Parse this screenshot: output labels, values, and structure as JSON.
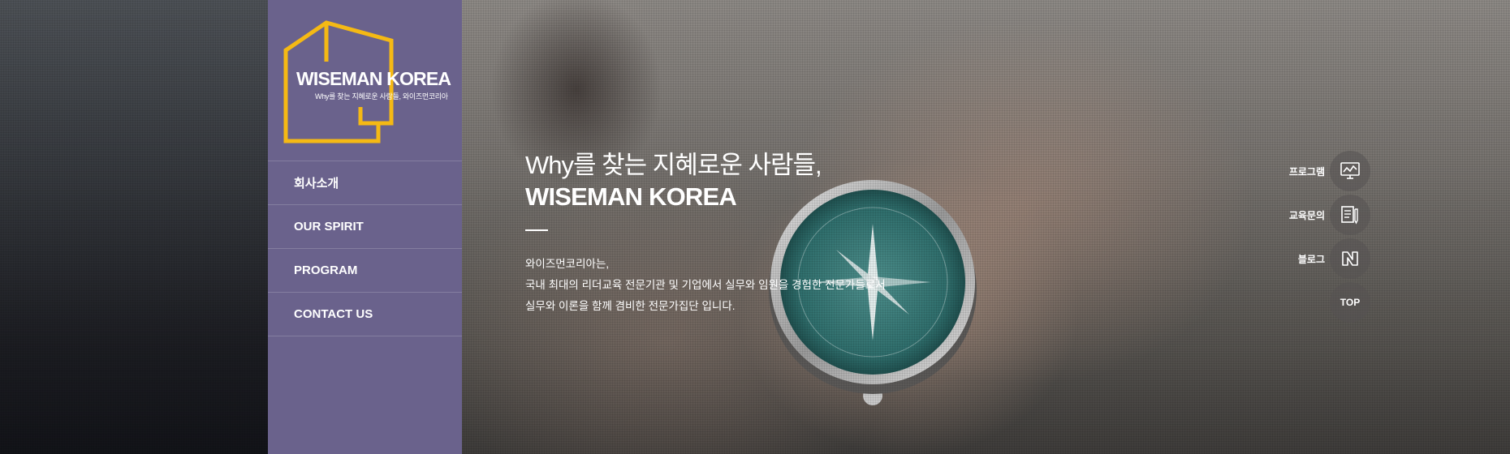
{
  "logo": {
    "title": "WISEMAN KOREA",
    "subtitle": "Why를 찾는 지혜로운 사람들, 와이즈먼코리아",
    "frame_color": "#f5b914"
  },
  "nav": {
    "items": [
      {
        "label": "회사소개"
      },
      {
        "label": "OUR SPIRIT"
      },
      {
        "label": "PROGRAM"
      },
      {
        "label": "CONTACT US"
      }
    ]
  },
  "hero": {
    "line1": "Why를 찾는 지혜로운 사람들,",
    "line2": "WISEMAN KOREA",
    "desc": [
      "와이즈먼코리아는,",
      "국내 최대의 리더교육 전문기관 및 기업에서 실무와 임원을 경험한 전문가들로서",
      "실무와 이론을 함께 겸비한 전문가집단 입니다."
    ]
  },
  "quick_menu": {
    "items": [
      {
        "label": "프로그램",
        "icon": "monitor-chart-icon"
      },
      {
        "label": "교육문의",
        "icon": "document-pen-icon"
      },
      {
        "label": "블로그",
        "icon": "naver-n-icon"
      }
    ],
    "top_label": "TOP"
  },
  "colors": {
    "sidebar": "#6a628c",
    "accent": "#f5b914"
  }
}
